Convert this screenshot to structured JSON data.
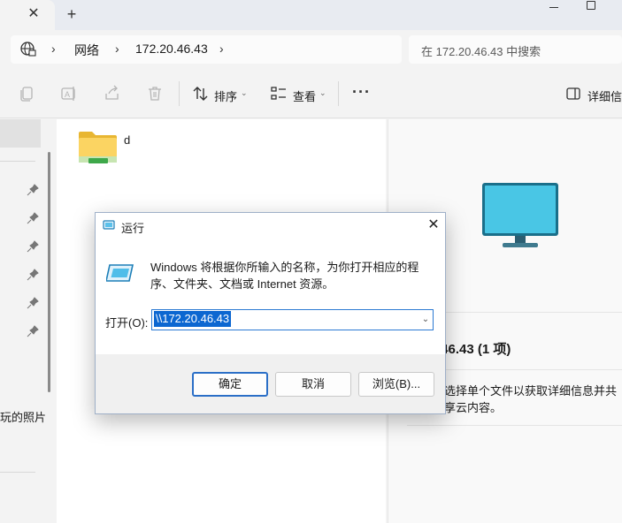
{
  "window": {
    "tab_close": "✕",
    "tab_add": "+"
  },
  "address": {
    "sep": "›",
    "crumbs": [
      "网络",
      "172.20.46.43"
    ],
    "search_placeholder": "在 172.20.46.43 中搜索"
  },
  "toolbar": {
    "sort_label": "排序",
    "view_label": "查看",
    "more": "···",
    "details_label": "详细信息"
  },
  "nav": {
    "partial_item": "玩的照片"
  },
  "content": {
    "items": [
      {
        "name": "d",
        "icon": "folder-shared-icon"
      }
    ]
  },
  "details_pane": {
    "title": ".46.43 (1 项)",
    "description": "选择单个文件以获取详细信息并共享云内容。"
  },
  "run_dialog": {
    "title": "运行",
    "message": "Windows 将根据你所输入的名称，为你打开相应的程序、文件夹、文档或 Internet 资源。",
    "open_label": "打开(O):",
    "open_value": "\\\\172.20.46.43",
    "ok_label": "确定",
    "cancel_label": "取消",
    "browse_label": "浏览(B)..."
  }
}
